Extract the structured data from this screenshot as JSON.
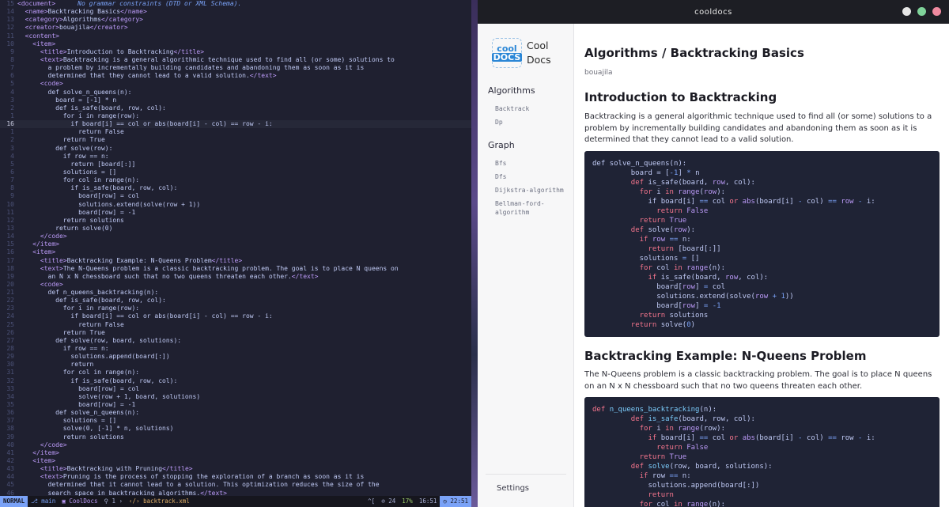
{
  "editor": {
    "lines": [
      {
        "n": "15",
        "t": "<document>",
        "hint": "No grammar constraints (DTD or XML Schema)."
      },
      {
        "n": "14",
        "t": "  <name>Backtracking Basics</name>"
      },
      {
        "n": "13",
        "t": "  <category>Algorithms</category>"
      },
      {
        "n": "12",
        "t": "  <creator>bouajila</creator>"
      },
      {
        "n": "11",
        "t": "  <content>"
      },
      {
        "n": "10",
        "t": "    <item>"
      },
      {
        "n": "9",
        "t": "      <title>Introduction to Backtracking</title>"
      },
      {
        "n": "8",
        "t": "      <text>Backtracking is a general algorithmic technique used to find all (or some) solutions to"
      },
      {
        "n": "7",
        "t": "        a problem by incrementally building candidates and abandoning them as soon as it is"
      },
      {
        "n": "6",
        "t": "        determined that they cannot lead to a valid solution.</text>"
      },
      {
        "n": "5",
        "t": "      <code>"
      },
      {
        "n": "4",
        "t": "        def solve_n_queens(n):"
      },
      {
        "n": "3",
        "t": "          board = [-1] * n"
      },
      {
        "n": "2",
        "t": "          def is_safe(board, row, col):"
      },
      {
        "n": "1",
        "t": "            for i in range(row):"
      },
      {
        "n": "16",
        "t": "              if board[i] == col or abs(board[i] - col) == row - i:",
        "cur": true
      },
      {
        "n": "1",
        "t": "                return False"
      },
      {
        "n": "2",
        "t": "            return True"
      },
      {
        "n": "3",
        "t": "          def solve(row):"
      },
      {
        "n": "4",
        "t": "            if row == n:"
      },
      {
        "n": "5",
        "t": "              return [board[:]]"
      },
      {
        "n": "6",
        "t": "            solutions = []"
      },
      {
        "n": "7",
        "t": "            for col in range(n):"
      },
      {
        "n": "8",
        "t": "              if is_safe(board, row, col):"
      },
      {
        "n": "9",
        "t": "                board[row] = col"
      },
      {
        "n": "10",
        "t": "                solutions.extend(solve(row + 1))"
      },
      {
        "n": "11",
        "t": "                board[row] = -1"
      },
      {
        "n": "12",
        "t": "            return solutions"
      },
      {
        "n": "13",
        "t": "          return solve(0)"
      },
      {
        "n": "14",
        "t": "      </code>"
      },
      {
        "n": "15",
        "t": "    </item>"
      },
      {
        "n": "16",
        "t": "    <item>"
      },
      {
        "n": "17",
        "t": "      <title>Backtracking Example: N-Queens Problem</title>"
      },
      {
        "n": "18",
        "t": "      <text>The N-Queens problem is a classic backtracking problem. The goal is to place N queens on"
      },
      {
        "n": "19",
        "t": "        an N x N chessboard such that no two queens threaten each other.</text>"
      },
      {
        "n": "20",
        "t": "      <code>"
      },
      {
        "n": "21",
        "t": "        def n_queens_backtracking(n):"
      },
      {
        "n": "22",
        "t": "          def is_safe(board, row, col):"
      },
      {
        "n": "23",
        "t": "            for i in range(row):"
      },
      {
        "n": "24",
        "t": "              if board[i] == col or abs(board[i] - col) == row - i:"
      },
      {
        "n": "25",
        "t": "                return False"
      },
      {
        "n": "26",
        "t": "            return True"
      },
      {
        "n": "27",
        "t": "          def solve(row, board, solutions):"
      },
      {
        "n": "28",
        "t": "            if row == n:"
      },
      {
        "n": "29",
        "t": "              solutions.append(board[:])"
      },
      {
        "n": "30",
        "t": "              return"
      },
      {
        "n": "31",
        "t": "            for col in range(n):"
      },
      {
        "n": "32",
        "t": "              if is_safe(board, row, col):"
      },
      {
        "n": "33",
        "t": "                board[row] = col"
      },
      {
        "n": "34",
        "t": "                solve(row + 1, board, solutions)"
      },
      {
        "n": "35",
        "t": "                board[row] = -1"
      },
      {
        "n": "36",
        "t": "          def solve_n_queens(n):"
      },
      {
        "n": "37",
        "t": "            solutions = []"
      },
      {
        "n": "38",
        "t": "            solve(0, [-1] * n, solutions)"
      },
      {
        "n": "39",
        "t": "            return solutions"
      },
      {
        "n": "40",
        "t": "      </code>"
      },
      {
        "n": "41",
        "t": "    </item>"
      },
      {
        "n": "42",
        "t": "    <item>"
      },
      {
        "n": "43",
        "t": "      <title>Backtracking with Pruning</title>"
      },
      {
        "n": "44",
        "t": "      <text>Pruning is the process of stopping the exploration of a branch as soon as it is"
      },
      {
        "n": "45",
        "t": "        determined that it cannot lead to a solution. This optimization reduces the size of the"
      },
      {
        "n": "46",
        "t": "        search space in backtracking algorithms.</text>"
      }
    ]
  },
  "statusline": {
    "mode": "NORMAL",
    "branch": "main",
    "project": "CoolDocs",
    "changes": "1",
    "file": "backtrack.xml",
    "fileformat": "^[",
    "diagnostics": "24",
    "percent": "17%",
    "position": "16:51",
    "time": "22:51"
  },
  "app": {
    "window_title": "cooldocs",
    "logo": {
      "badge_line1": "cool",
      "badge_line2": "DOCS",
      "text_line1": "Cool",
      "text_line2": "Docs"
    },
    "sidebar": {
      "sections": [
        {
          "label": "Algorithms",
          "items": [
            "Backtrack",
            "Dp"
          ]
        },
        {
          "label": "Graph",
          "items": [
            "Bfs",
            "Dfs",
            "Dijkstra-algorithm",
            "Bellman-ford-",
            "algorithm"
          ]
        }
      ],
      "settings_label": "Settings"
    },
    "main": {
      "page_title": "Algorithms / Backtracking Basics",
      "author": "bouajila",
      "section1_title": "Introduction to Backtracking",
      "section1_text": "Backtracking is a general algorithmic technique used to find all (or some) solutions to a problem by incrementally building candidates and abandoning them as soon as it is determined that they cannot lead to a valid solution.",
      "section2_title": "Backtracking Example: N-Queens Problem",
      "section2_text": "The N-Queens problem is a classic backtracking problem. The goal is to place N queens on an N x N chessboard such that no two queens threaten each other."
    }
  }
}
